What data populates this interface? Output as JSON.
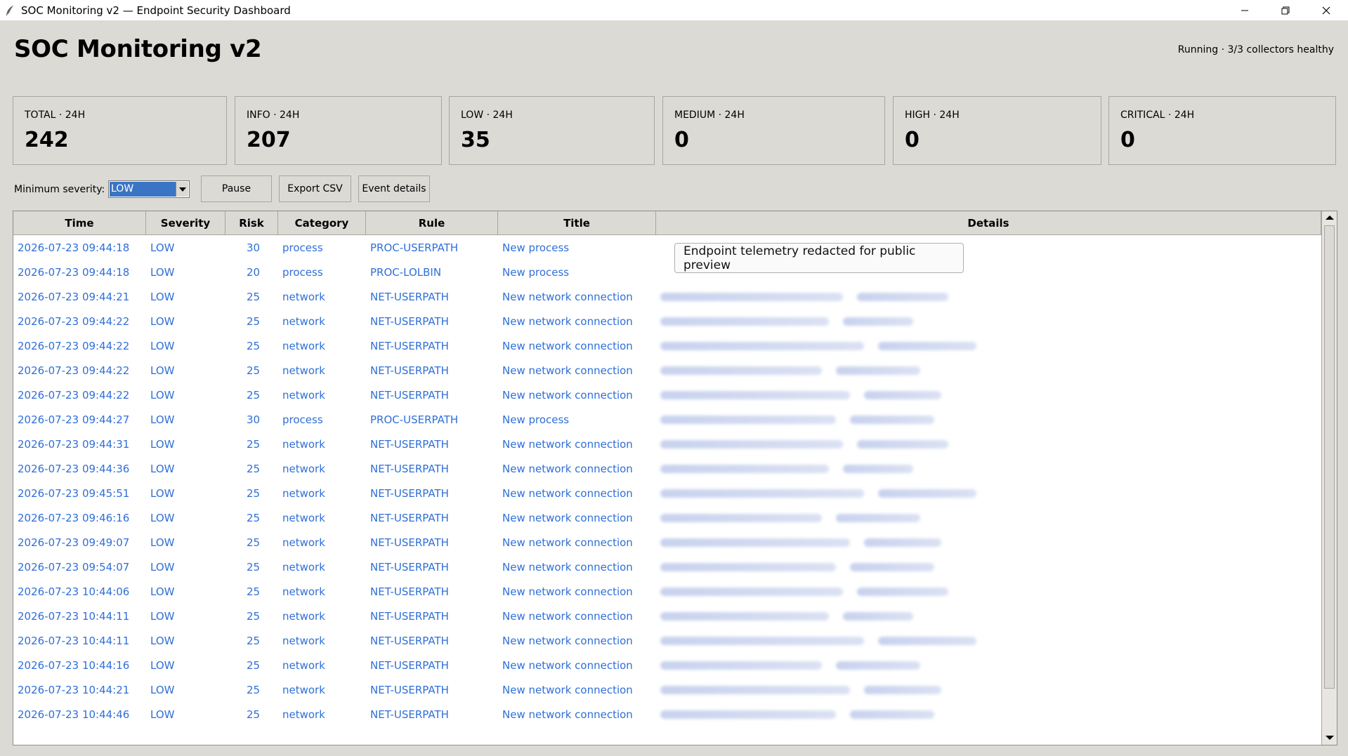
{
  "window": {
    "title": "SOC Monitoring v2 — Endpoint Security Dashboard"
  },
  "header": {
    "app_title": "SOC Monitoring v2",
    "status": "Running · 3/3 collectors healthy"
  },
  "cards": [
    {
      "label": "TOTAL · 24H",
      "value": "242"
    },
    {
      "label": "INFO · 24H",
      "value": "207"
    },
    {
      "label": "LOW · 24H",
      "value": "35"
    },
    {
      "label": "MEDIUM · 24H",
      "value": "0"
    },
    {
      "label": "HIGH · 24H",
      "value": "0"
    },
    {
      "label": "CRITICAL · 24H",
      "value": "0"
    }
  ],
  "controls": {
    "min_severity_label": "Minimum severity:",
    "min_severity_value": "LOW",
    "pause_label": "Pause",
    "export_label": "Export CSV",
    "details_label": "Event details"
  },
  "table": {
    "columns": [
      "Time",
      "Severity",
      "Risk",
      "Category",
      "Rule",
      "Title",
      "Details"
    ],
    "rows": [
      {
        "time": "2026-07-23 09:44:18",
        "severity": "LOW",
        "risk": "30",
        "category": "process",
        "rule": "PROC-USERPATH",
        "title": "New process"
      },
      {
        "time": "2026-07-23 09:44:18",
        "severity": "LOW",
        "risk": "20",
        "category": "process",
        "rule": "PROC-LOLBIN",
        "title": "New process"
      },
      {
        "time": "2026-07-23 09:44:21",
        "severity": "LOW",
        "risk": "25",
        "category": "network",
        "rule": "NET-USERPATH",
        "title": "New network connection"
      },
      {
        "time": "2026-07-23 09:44:22",
        "severity": "LOW",
        "risk": "25",
        "category": "network",
        "rule": "NET-USERPATH",
        "title": "New network connection"
      },
      {
        "time": "2026-07-23 09:44:22",
        "severity": "LOW",
        "risk": "25",
        "category": "network",
        "rule": "NET-USERPATH",
        "title": "New network connection"
      },
      {
        "time": "2026-07-23 09:44:22",
        "severity": "LOW",
        "risk": "25",
        "category": "network",
        "rule": "NET-USERPATH",
        "title": "New network connection"
      },
      {
        "time": "2026-07-23 09:44:22",
        "severity": "LOW",
        "risk": "25",
        "category": "network",
        "rule": "NET-USERPATH",
        "title": "New network connection"
      },
      {
        "time": "2026-07-23 09:44:27",
        "severity": "LOW",
        "risk": "30",
        "category": "process",
        "rule": "PROC-USERPATH",
        "title": "New process"
      },
      {
        "time": "2026-07-23 09:44:31",
        "severity": "LOW",
        "risk": "25",
        "category": "network",
        "rule": "NET-USERPATH",
        "title": "New network connection"
      },
      {
        "time": "2026-07-23 09:44:36",
        "severity": "LOW",
        "risk": "25",
        "category": "network",
        "rule": "NET-USERPATH",
        "title": "New network connection"
      },
      {
        "time": "2026-07-23 09:45:51",
        "severity": "LOW",
        "risk": "25",
        "category": "network",
        "rule": "NET-USERPATH",
        "title": "New network connection"
      },
      {
        "time": "2026-07-23 09:46:16",
        "severity": "LOW",
        "risk": "25",
        "category": "network",
        "rule": "NET-USERPATH",
        "title": "New network connection"
      },
      {
        "time": "2026-07-23 09:49:07",
        "severity": "LOW",
        "risk": "25",
        "category": "network",
        "rule": "NET-USERPATH",
        "title": "New network connection"
      },
      {
        "time": "2026-07-23 09:54:07",
        "severity": "LOW",
        "risk": "25",
        "category": "network",
        "rule": "NET-USERPATH",
        "title": "New network connection"
      },
      {
        "time": "2026-07-23 10:44:06",
        "severity": "LOW",
        "risk": "25",
        "category": "network",
        "rule": "NET-USERPATH",
        "title": "New network connection"
      },
      {
        "time": "2026-07-23 10:44:11",
        "severity": "LOW",
        "risk": "25",
        "category": "network",
        "rule": "NET-USERPATH",
        "title": "New network connection"
      },
      {
        "time": "2026-07-23 10:44:11",
        "severity": "LOW",
        "risk": "25",
        "category": "network",
        "rule": "NET-USERPATH",
        "title": "New network connection"
      },
      {
        "time": "2026-07-23 10:44:16",
        "severity": "LOW",
        "risk": "25",
        "category": "network",
        "rule": "NET-USERPATH",
        "title": "New network connection"
      },
      {
        "time": "2026-07-23 10:44:21",
        "severity": "LOW",
        "risk": "25",
        "category": "network",
        "rule": "NET-USERPATH",
        "title": "New network connection"
      },
      {
        "time": "2026-07-23 10:44:46",
        "severity": "LOW",
        "risk": "25",
        "category": "network",
        "rule": "NET-USERPATH",
        "title": "New network connection"
      }
    ]
  },
  "redaction_note": "Endpoint telemetry redacted for public preview",
  "colors": {
    "row_text": "#2f6fd8",
    "selection": "#3a74c4",
    "background": "#dcdad5"
  },
  "icons": {
    "app": "feather-icon",
    "minimize": "minimize-icon",
    "restore": "restore-icon",
    "close": "close-icon",
    "dropdown": "chevron-down-icon"
  }
}
